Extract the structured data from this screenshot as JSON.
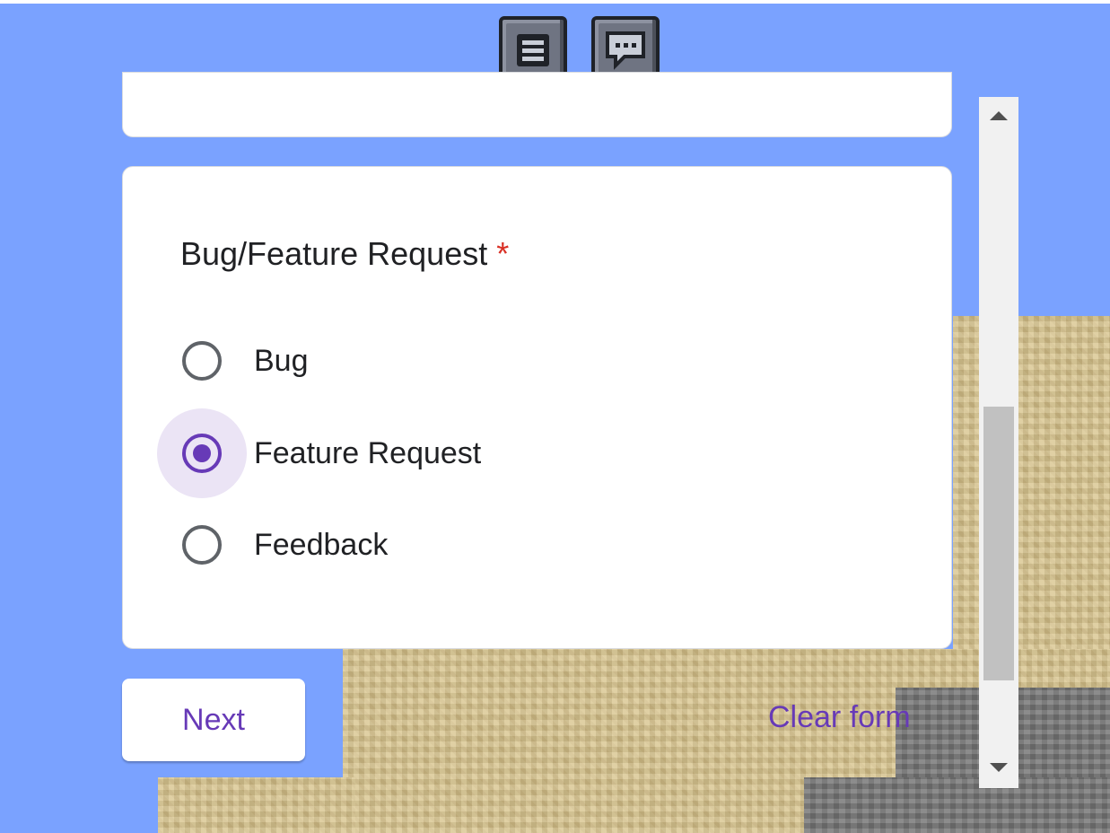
{
  "toolbar": {
    "menu_icon": "menu-icon",
    "chat_icon": "chat-icon"
  },
  "question": {
    "title": "Bug/Feature Request",
    "required_marker": "*",
    "options": [
      {
        "label": "Bug",
        "selected": false
      },
      {
        "label": "Feature Request",
        "selected": true
      },
      {
        "label": "Feedback",
        "selected": false
      }
    ]
  },
  "actions": {
    "next_label": "Next",
    "clear_label": "Clear form"
  },
  "colors": {
    "sky": "#7aa2ff",
    "accent": "#673ab7",
    "required": "#d93025"
  }
}
